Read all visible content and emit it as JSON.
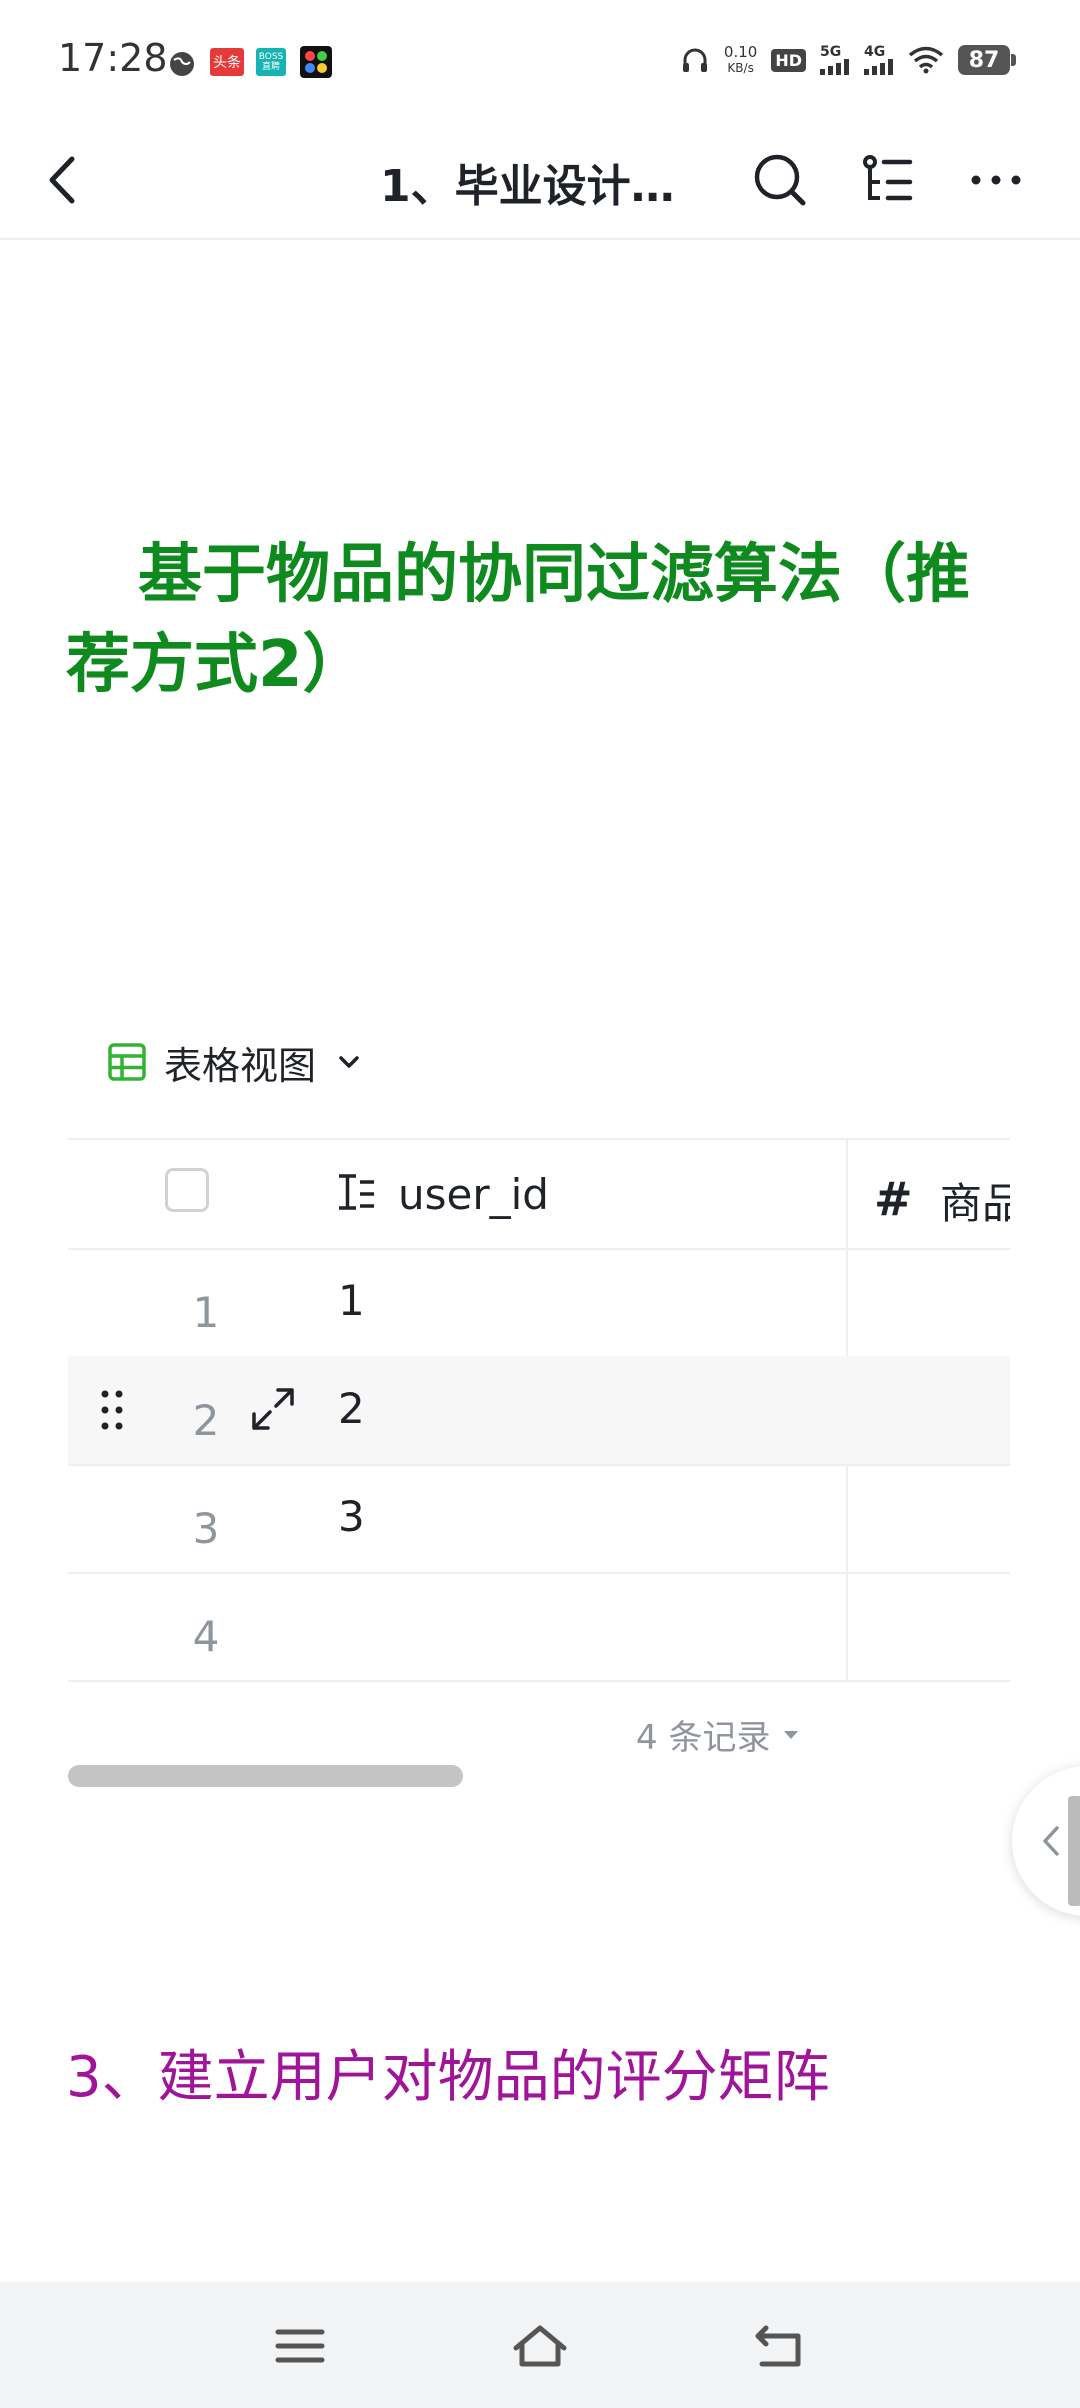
{
  "status_bar": {
    "time": "17:28",
    "app_badges": [
      "头条",
      "BOSS直聘"
    ],
    "net_speed_value": "0.10",
    "net_speed_unit": "KB/s",
    "hd": "HD",
    "sig1": "5G",
    "sig2": "4G",
    "battery": "87"
  },
  "nav": {
    "title": "1、毕业设计…",
    "icons": [
      "back-icon",
      "search-icon",
      "outline-icon",
      "more-icon"
    ]
  },
  "heading": "基于物品的协同过滤算法（推荐方式2）",
  "view": {
    "label": "表格视图"
  },
  "table": {
    "columns": [
      {
        "label": "user_id",
        "icon": "text-field-icon"
      },
      {
        "label": "商品",
        "icon": "number-field-icon"
      }
    ],
    "rows": [
      {
        "num": "1",
        "user_id": "1"
      },
      {
        "num": "2",
        "user_id": "2"
      },
      {
        "num": "3",
        "user_id": "3"
      },
      {
        "num": "4",
        "user_id": ""
      }
    ],
    "record_count": "4 条记录"
  },
  "subheading": "3、建立用户对物品的评分矩阵",
  "colors": {
    "heading": "#0f8a1f",
    "subheading": "#a0149a",
    "table_icon": "#34b233"
  }
}
